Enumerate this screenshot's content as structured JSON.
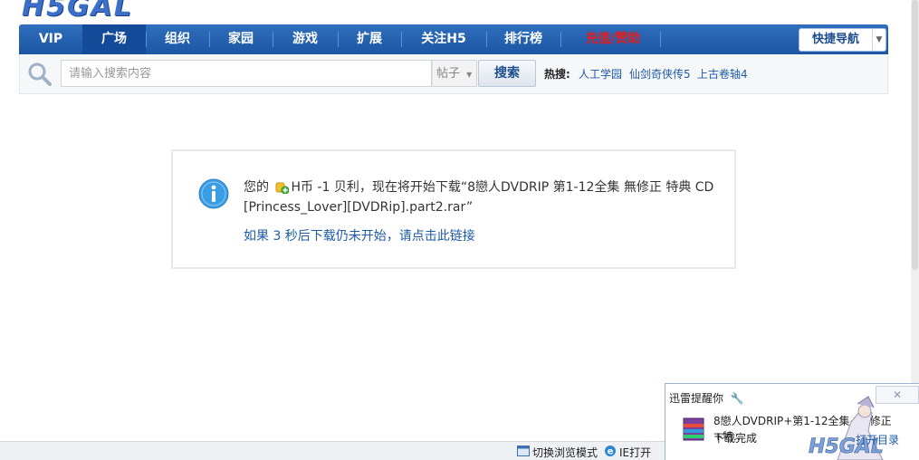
{
  "logo": {
    "text": "H5GAL"
  },
  "nav": {
    "items": [
      {
        "label": "VIP"
      },
      {
        "label": "广场"
      },
      {
        "label": "组织"
      },
      {
        "label": "家园"
      },
      {
        "label": "游戏"
      },
      {
        "label": "扩展"
      },
      {
        "label": "关注H5"
      },
      {
        "label": "排行榜"
      },
      {
        "label": "充值/赞助"
      }
    ],
    "active_item": "广场",
    "quick_nav_label": "快捷导航"
  },
  "search": {
    "placeholder": "请输入搜索内容",
    "type_selected": "帖子",
    "button_label": "搜索",
    "hot_label": "热搜:",
    "hot_links": [
      "人工学园",
      "仙剑奇侠传5",
      "上古卷轴4"
    ]
  },
  "message": {
    "line_prefix": "您的",
    "line_body": "H币 -1 贝利，现在将开始下载“8戀人DVDRIP 第1-12全集 無修正 特典 CD [Princess_Lover][DVDRip].part2.rar”",
    "link_text": "如果 3 秒后下载仍未开始，请点击此链接"
  },
  "statusbar": {
    "switch_label": "切换浏览模式",
    "ie_label": "IE打开"
  },
  "popup": {
    "title": "迅雷提醒你",
    "close_icon": "close-icon",
    "file_name": "8戀人DVDRIP+第1-12全集+無修正+特...",
    "status": "下载完成",
    "link": "打开目录"
  },
  "colors": {
    "nav_bg": "#2f6fbd",
    "nav_active": "#134b99",
    "link": "#1d5aa8",
    "red": "#e41c1c"
  }
}
